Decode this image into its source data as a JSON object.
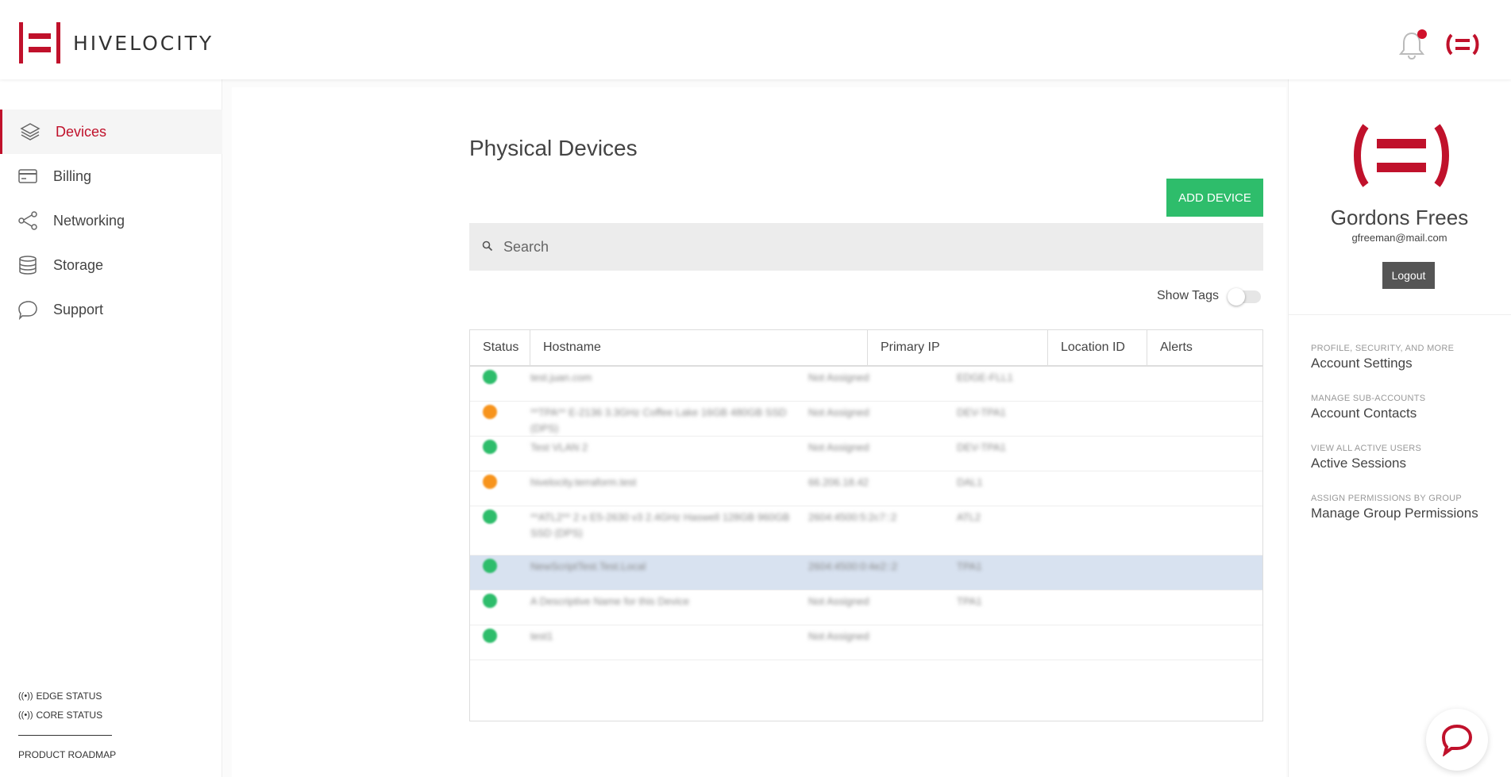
{
  "header": {
    "brand": "HIVELOCITY",
    "notification_count": 1,
    "accent_color": "#c0112b"
  },
  "sidebar": {
    "items": [
      {
        "label": "Devices",
        "icon": "layers-icon",
        "active": true
      },
      {
        "label": "Billing",
        "icon": "credit-card-icon",
        "active": false
      },
      {
        "label": "Networking",
        "icon": "share-icon",
        "active": false
      },
      {
        "label": "Storage",
        "icon": "database-icon",
        "active": false
      },
      {
        "label": "Support",
        "icon": "chat-bubble-icon",
        "active": false
      }
    ],
    "edge_status": "EDGE STATUS",
    "core_status": "CORE STATUS",
    "roadmap": "PRODUCT ROADMAP"
  },
  "main": {
    "title": "Physical Devices",
    "add_button": "ADD DEVICE",
    "search_placeholder": "Search",
    "show_tags_label": "Show Tags",
    "show_tags_on": false,
    "table": {
      "columns": [
        "Status",
        "Hostname",
        "Primary IP",
        "Location ID",
        "Alerts"
      ],
      "rows": [
        {
          "status": "green",
          "hostname": "test.juan.com",
          "ip": "Not Assigned",
          "location": "EDGE-FLL1",
          "alerts": ""
        },
        {
          "status": "orange",
          "hostname": "**TPA** E-2136 3.3GHz Coffee Lake 16GB 480GB SSD (DPS)",
          "ip": "Not Assigned",
          "location": "DEV-TPA1",
          "alerts": ""
        },
        {
          "status": "green",
          "hostname": "Test VLAN 2",
          "ip": "Not Assigned",
          "location": "DEV-TPA1",
          "alerts": ""
        },
        {
          "status": "orange",
          "hostname": "hivelocity.terraform.test",
          "ip": "66.206.18.42",
          "location": "DAL1",
          "alerts": ""
        },
        {
          "status": "green",
          "hostname": "**ATL2** 2 x E5-2630 v3 2.4GHz Haswell 128GB 960GB SSD (DPS)",
          "ip": "2604:4500:5:2c7::2",
          "location": "ATL2",
          "alerts": ""
        },
        {
          "status": "green",
          "hostname": "NewScriptTest.Test.Local",
          "ip": "2604:4500:0:4e2::2",
          "location": "TPA1",
          "alerts": "",
          "selected": true
        },
        {
          "status": "green",
          "hostname": "A Descriptive Name for this Device",
          "ip": "Not Assigned",
          "location": "TPA1",
          "alerts": ""
        },
        {
          "status": "green",
          "hostname": "test1",
          "ip": "Not Assigned",
          "location": "",
          "alerts": ""
        }
      ]
    }
  },
  "profile": {
    "name": "Gordons Frees",
    "email": "gfreeman@mail.com",
    "logout": "Logout",
    "links": [
      {
        "caption": "PROFILE, SECURITY, AND MORE",
        "title": "Account Settings"
      },
      {
        "caption": "MANAGE SUB-ACCOUNTS",
        "title": "Account Contacts"
      },
      {
        "caption": "VIEW ALL ACTIVE USERS",
        "title": "Active Sessions"
      },
      {
        "caption": "ASSIGN PERMISSIONS BY GROUP",
        "title": "Manage Group Permissions"
      }
    ]
  },
  "colors": {
    "status_green": "#2ebd6b",
    "status_orange": "#f7941d",
    "add_button": "#2ebd6b"
  }
}
